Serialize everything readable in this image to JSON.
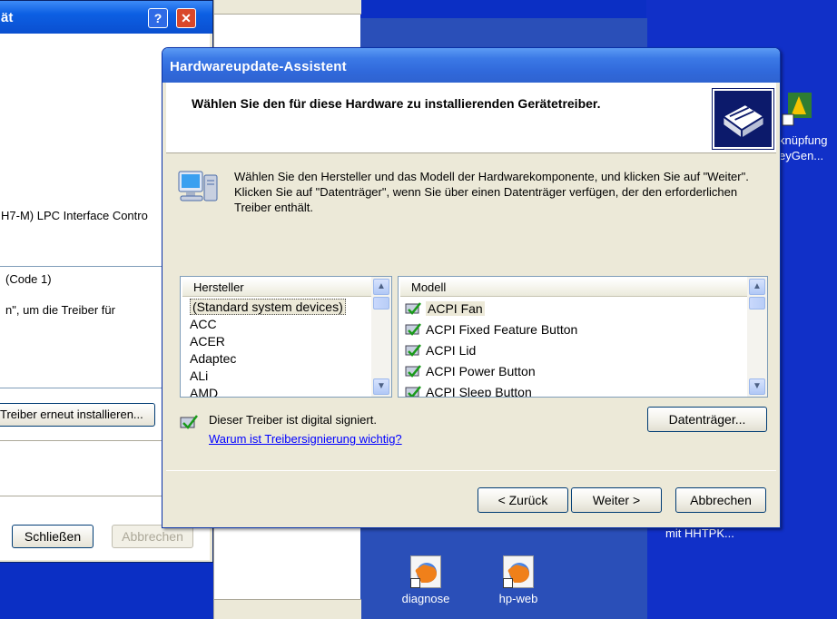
{
  "colors": {
    "desktop_blue": "#0b2fc4",
    "title_blue": "#3068da",
    "dialog_face": "#ece9d8",
    "link_blue": "#0000ff"
  },
  "background_window": {
    "title": "ät",
    "help_label": "?",
    "close_label": "✕",
    "device_name": "H7-M) LPC Interface Contro",
    "status_code": "(Code 1)",
    "status_text": "n\", um die Treiber für",
    "reinstall_button": "Treiber erneut installieren...",
    "close_button": "Schließen",
    "cancel_button": "Abbrechen"
  },
  "wizard": {
    "title": "Hardwareupdate-Assistent",
    "heading": "Wählen Sie den für diese Hardware zu installierenden Gerätetreiber.",
    "instructions": "Wählen Sie den Hersteller und das Modell der Hardwarekomponente, und klicken Sie auf \"Weiter\". Klicken Sie auf \"Datenträger\", wenn Sie über einen Datenträger verfügen, der den erforderlichen Treiber enthält.",
    "manufacturer": {
      "header": "Hersteller",
      "items": [
        "(Standard system devices)",
        "ACC",
        "ACER",
        "Adaptec",
        "ALi",
        "AMD"
      ],
      "selected": "(Standard system devices)"
    },
    "model": {
      "header": "Modell",
      "items": [
        "ACPI Fan",
        "ACPI Fixed Feature Button",
        "ACPI Lid",
        "ACPI Power Button",
        "ACPI Sleep Button"
      ],
      "selected": "ACPI Fan"
    },
    "signed_text": "Dieser Treiber ist digital signiert.",
    "signing_link": "Warum ist Treibersignierung wichtig?",
    "disk_button": "Datenträger...",
    "back_button": "< Zurück",
    "next_button": "Weiter >",
    "cancel_button": "Abbrechen"
  },
  "desktop": {
    "icons": [
      {
        "label": "diagnose",
        "icon": "firefox-shortcut-icon"
      },
      {
        "label": "hp-web",
        "icon": "firefox-shortcut-icon"
      }
    ],
    "right_icon_label_1": "knüpfung",
    "right_icon_label_2": "eyGen...",
    "right_label_3": "mit HHTPK..."
  }
}
